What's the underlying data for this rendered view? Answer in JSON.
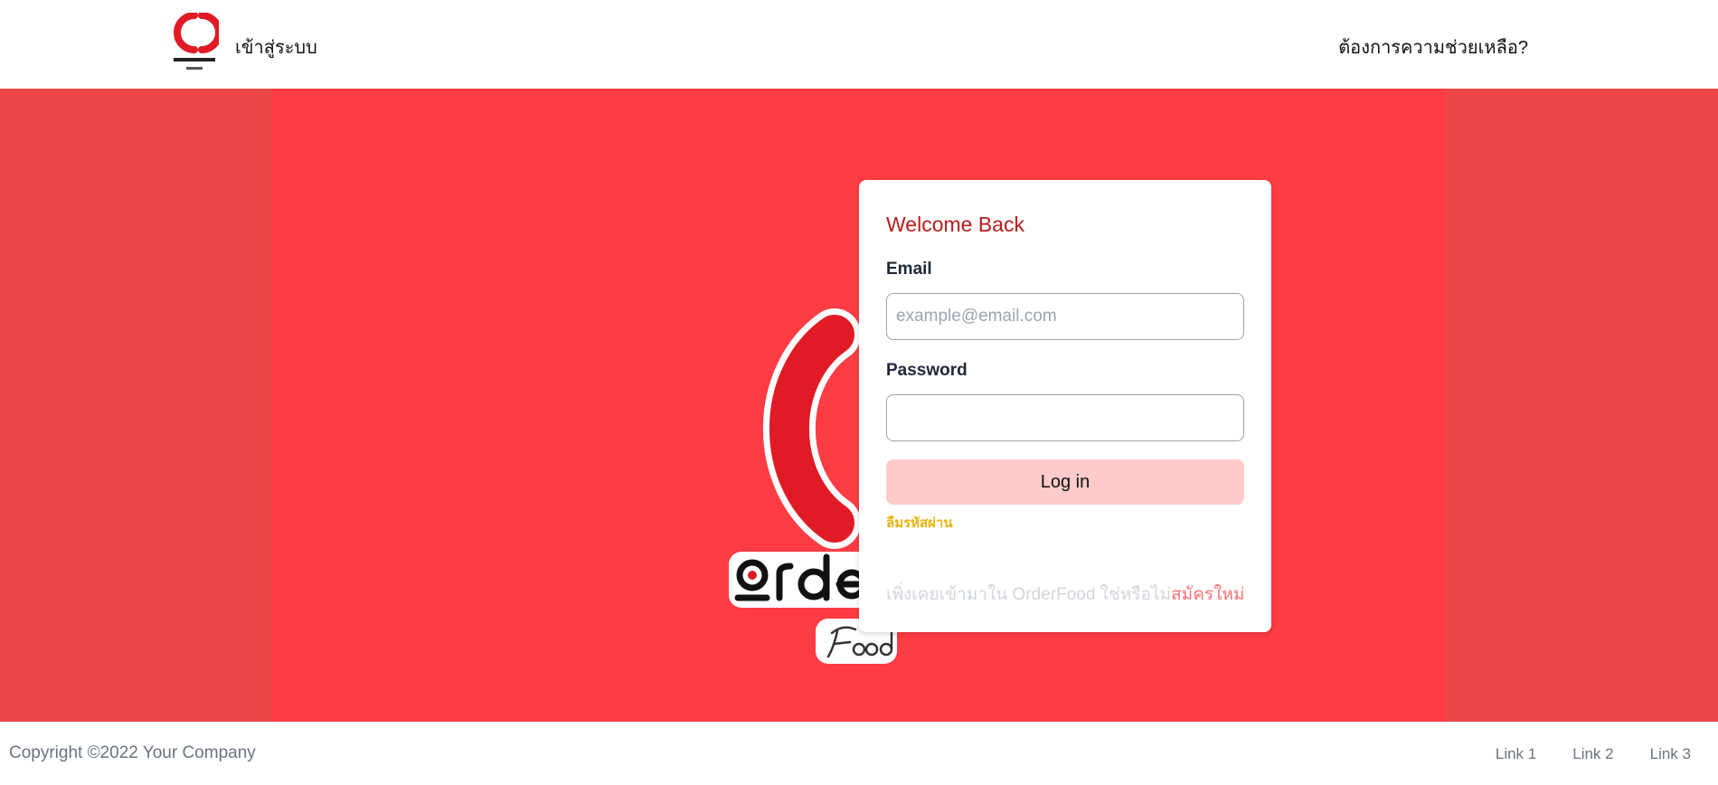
{
  "header": {
    "logo_icon": "orderfood-logo-icon",
    "title": "เข้าสู่ระบบ",
    "help_link": "ต้องการความช่วยเหลือ?"
  },
  "hero": {
    "logo_icon": "orderfood-logo-icon",
    "logo_wordmark": "Orderfood",
    "logo_subtitle": "Food"
  },
  "login": {
    "title": "Welcome Back",
    "email_label": "Email",
    "email_placeholder": "example@email.com",
    "email_value": "",
    "password_label": "Password",
    "password_value": "",
    "login_button": "Log in",
    "forgot_password": "ลืมรหัสผ่าน",
    "signup_prompt": "เพิ่งเคยเข้ามาใน OrderFood ใช่หรือไม่",
    "signup_link": "สมัครใหม่"
  },
  "footer": {
    "copyright": "Copyright ©2022 Your Company",
    "links": [
      "Link 1",
      "Link 2",
      "Link 3"
    ]
  },
  "colors": {
    "accent": "#ff3b43",
    "hero_side": "#ec4747",
    "logo_red": "#e01b25",
    "title_red": "#b91c1c",
    "button_bg": "#fecaca",
    "forgot_yellow": "#eab308",
    "signup_red": "#f87171"
  }
}
